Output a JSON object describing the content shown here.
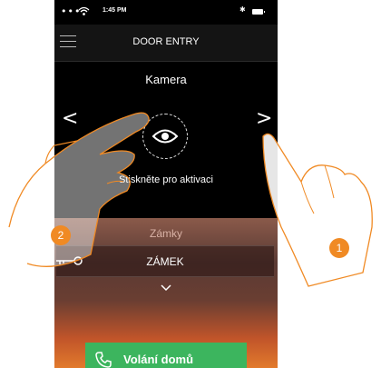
{
  "status_bar": {
    "signal": "•••",
    "time": "1:45 PM",
    "bluetooth": "✱"
  },
  "nav": {
    "title": "DOOR ENTRY",
    "menu_icon": "hamburger-menu-icon"
  },
  "camera": {
    "title": "Kamera",
    "activate_text": "Stiskněte pro aktivaci",
    "prev_arrow": "<",
    "next_arrow": ">",
    "eye_icon": "eye-icon"
  },
  "locks": {
    "title": "Zámky",
    "items": [
      {
        "label": "ZÁMEK",
        "icon": "key-icon"
      }
    ],
    "expand_icon": "⌄"
  },
  "call_button": {
    "label": "Volání domů",
    "icon": "phone-icon"
  },
  "callouts": [
    {
      "number": "1"
    },
    {
      "number": "2"
    }
  ],
  "colors": {
    "accent_green": "#3cb55e",
    "callout_orange": "#f08a24",
    "background": "#000000"
  }
}
